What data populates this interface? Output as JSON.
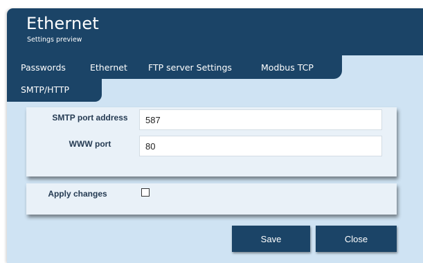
{
  "header": {
    "title": "Ethernet",
    "subtitle": "Settings preview"
  },
  "tabs": [
    {
      "label": "Passwords"
    },
    {
      "label": "Ethernet"
    },
    {
      "label": "FTP server Settings"
    },
    {
      "label": "Modbus TCP"
    },
    {
      "label": "SMTP/HTTP",
      "active": true
    }
  ],
  "form": {
    "smtp_port_label": "SMTP port address",
    "smtp_port_value": "587",
    "www_port_label": "WWW port",
    "www_port_value": "80"
  },
  "apply": {
    "label": "Apply changes",
    "checked": false
  },
  "buttons": {
    "save_label": "Save",
    "close_label": "Close"
  },
  "colors": {
    "primary": "#1b4467",
    "background": "#cfe3f3",
    "panel": "#e9f1f8"
  }
}
